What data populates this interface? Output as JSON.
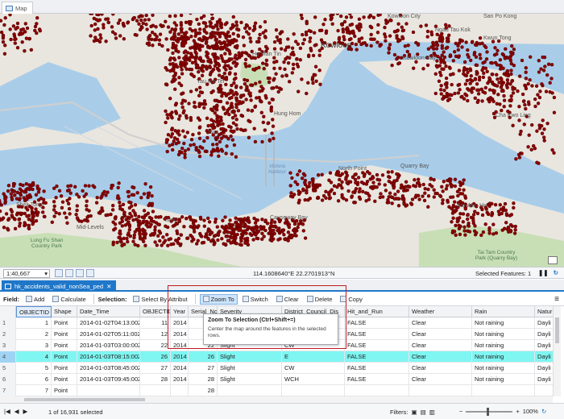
{
  "map_tab": {
    "label": "Map"
  },
  "map": {
    "labels": {
      "kowloon": "Kowloon",
      "ho_man_tin": "Ho Man Tin",
      "yau_ma_tei": "Yau Ma Tei",
      "hung_hom": "Hung Hom",
      "tsim_sha_tsui": "Tsim",
      "kowloon_city": "Kowloon City",
      "san_po_kong": "San Po Kong",
      "kowloon_bay": "Kowloon Bay",
      "ngau_tau_kok": "Ngau Tau Kok",
      "kwun_tong": "Kwun Tong",
      "cha_kwo_ling": "Cha Kwo Ling",
      "north_point": "North Point",
      "quarry_bay": "Quarry Bay",
      "sai_wan_ho": "Sai Wan Ho",
      "causeway_bay": "Causeway Bay",
      "district": "istrict",
      "mid_levels": "Mid-Levels",
      "shek_tong": "Shek Tong",
      "lung_fu_shan": "Lung Fu Shan Country Park",
      "tai_tam": "Tai Tam Country Park (Quarry Bay)",
      "victoria_harbour": "Victoria Harbour"
    }
  },
  "map_status": {
    "scale": "1:40,667",
    "coords": "114.1608640°E 22.2701913°N",
    "selected_features": "Selected Features: 1"
  },
  "table_tab": {
    "label": "hk_accidents_valid_nonSea_ped"
  },
  "toolbar": {
    "field_label": "Field:",
    "add": "Add",
    "calculate": "Calculate",
    "selection_label": "Selection:",
    "select_by_attributes": "Select By Attribut",
    "zoom_to": "Zoom To",
    "switch": "Switch",
    "clear": "Clear",
    "delete": "Delete",
    "copy": "Copy"
  },
  "tooltip": {
    "title": "Zoom To Selection (Ctrl+Shift+=)",
    "body": "Center the map around the features in the selected rows."
  },
  "table": {
    "columns": [
      "OBJECTID",
      "Shape",
      "Date_Time",
      "OBJECTID",
      "Year",
      "Serial_No",
      "Severity",
      "District_Council_Dis",
      "Hit_and_Run",
      "Weather",
      "Rain",
      "Natur"
    ],
    "rows": [
      {
        "n": "1",
        "cells": [
          "1",
          "Point",
          "2014-01-02T04:13:00Z",
          "11",
          "2014",
          "11",
          "",
          "",
          "FALSE",
          "Clear",
          "Not raining",
          "Dayli"
        ]
      },
      {
        "n": "2",
        "cells": [
          "2",
          "Point",
          "2014-01-02T05:11:00Z",
          "12",
          "2014",
          "12",
          "",
          "",
          "FALSE",
          "Clear",
          "Not raining",
          "Dayli"
        ]
      },
      {
        "n": "3",
        "cells": [
          "3",
          "Point",
          "2014-01-03T03:00:00Z",
          "22",
          "2014",
          "22",
          "Slight",
          "CW",
          "FALSE",
          "Clear",
          "Not raining",
          "Dayli"
        ]
      },
      {
        "n": "4",
        "cells": [
          "4",
          "Point",
          "2014-01-03T08:15:00Z",
          "26",
          "2014",
          "26",
          "Slight",
          "E",
          "FALSE",
          "Clear",
          "Not raining",
          "Dayli"
        ]
      },
      {
        "n": "5",
        "cells": [
          "5",
          "Point",
          "2014-01-03T08:45:00Z",
          "27",
          "2014",
          "27",
          "Slight",
          "CW",
          "FALSE",
          "Clear",
          "Not raining",
          "Dayli"
        ]
      },
      {
        "n": "6",
        "cells": [
          "6",
          "Point",
          "2014-01-03T09:45:00Z",
          "28",
          "2014",
          "28",
          "Slight",
          "WCH",
          "FALSE",
          "Clear",
          "Not raining",
          "Dayli"
        ]
      },
      {
        "n": "7",
        "cells": [
          "7",
          "Point",
          "",
          "",
          "",
          "28",
          "",
          "",
          "",
          "",
          "",
          ""
        ]
      }
    ]
  },
  "status": {
    "selected": "1 of 16,931 selected",
    "filters_label": "Filters:",
    "zoom": "100%"
  },
  "colors": {
    "accent": "#1f77c9",
    "selected_row": "#7ff6f2",
    "point": "#8b0000",
    "water": "#a9cde9",
    "land": "#e9e6df",
    "park": "#c8dfb6"
  }
}
